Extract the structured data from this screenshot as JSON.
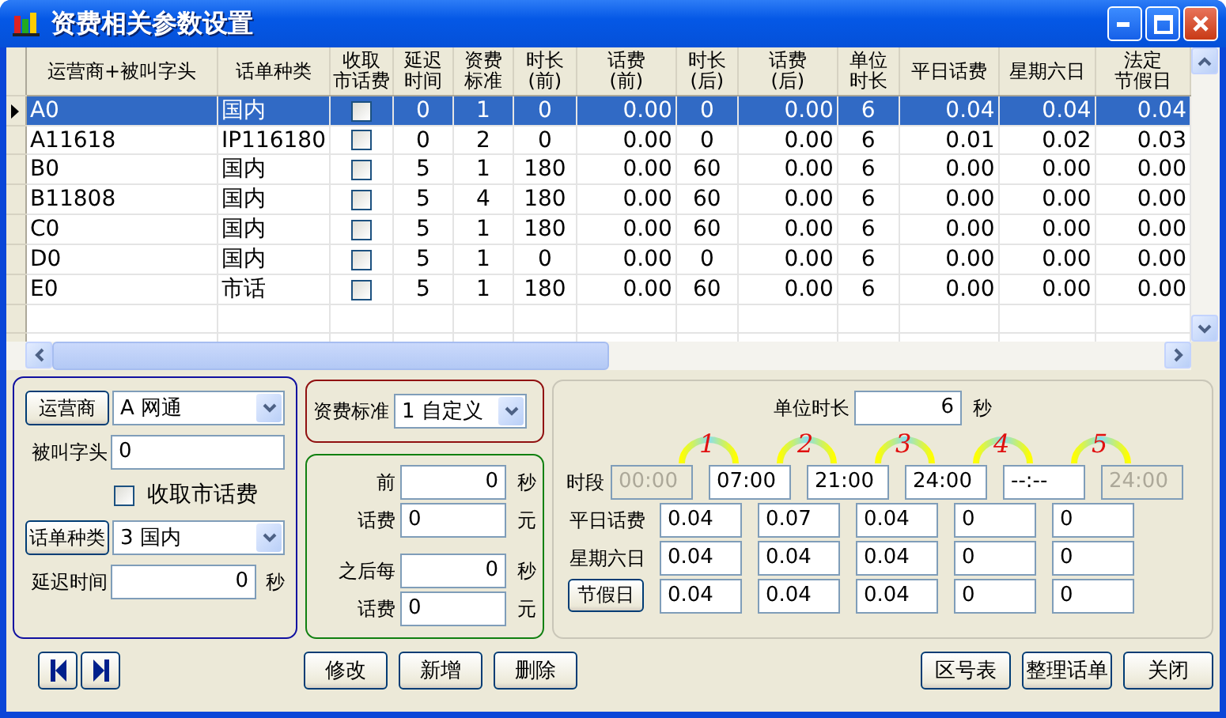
{
  "window": {
    "title": "资费相关参数设置"
  },
  "grid": {
    "columns": [
      {
        "lines": [
          "运营商+被叫字头"
        ],
        "kind": "text"
      },
      {
        "lines": [
          "话单种类"
        ],
        "kind": "text"
      },
      {
        "lines": [
          "收取",
          "市话费"
        ],
        "kind": "check"
      },
      {
        "lines": [
          "延迟",
          "时间"
        ],
        "kind": "text"
      },
      {
        "lines": [
          "资费",
          "标准"
        ],
        "kind": "text"
      },
      {
        "lines": [
          "时长",
          "(前)"
        ],
        "kind": "text"
      },
      {
        "lines": [
          "话费",
          "(前)"
        ],
        "kind": "text"
      },
      {
        "lines": [
          "时长",
          "(后)"
        ],
        "kind": "text"
      },
      {
        "lines": [
          "话费",
          "(后)"
        ],
        "kind": "text"
      },
      {
        "lines": [
          "单位",
          "时长"
        ],
        "kind": "text"
      },
      {
        "lines": [
          "平日话费"
        ],
        "kind": "text"
      },
      {
        "lines": [
          "星期六日"
        ],
        "kind": "text"
      },
      {
        "lines": [
          "法定",
          "节假日"
        ],
        "kind": "text"
      }
    ],
    "rows": [
      {
        "selected": true,
        "city_fee": false,
        "cells": [
          "A0",
          "国内",
          "",
          "0",
          "1",
          "0",
          "0.00",
          "0",
          "0.00",
          "6",
          "0.04",
          "0.04",
          "0.04"
        ]
      },
      {
        "selected": false,
        "city_fee": false,
        "cells": [
          "A11618",
          "IP116180",
          "",
          "0",
          "2",
          "0",
          "0.00",
          "0",
          "0.00",
          "6",
          "0.01",
          "0.02",
          "0.03"
        ]
      },
      {
        "selected": false,
        "city_fee": false,
        "cells": [
          "B0",
          "国内",
          "",
          "5",
          "1",
          "180",
          "0.00",
          "60",
          "0.00",
          "6",
          "0.00",
          "0.00",
          "0.00"
        ]
      },
      {
        "selected": false,
        "city_fee": false,
        "cells": [
          "B11808",
          "国内",
          "",
          "5",
          "4",
          "180",
          "0.00",
          "60",
          "0.00",
          "6",
          "0.00",
          "0.00",
          "0.00"
        ]
      },
      {
        "selected": false,
        "city_fee": false,
        "cells": [
          "C0",
          "国内",
          "",
          "5",
          "1",
          "180",
          "0.00",
          "60",
          "0.00",
          "6",
          "0.00",
          "0.00",
          "0.00"
        ]
      },
      {
        "selected": false,
        "city_fee": false,
        "cells": [
          "D0",
          "国内",
          "",
          "5",
          "1",
          "0",
          "0.00",
          "0",
          "0.00",
          "6",
          "0.00",
          "0.00",
          "0.00"
        ]
      },
      {
        "selected": false,
        "city_fee": false,
        "cells": [
          "E0",
          "市话",
          "",
          "5",
          "1",
          "180",
          "0.00",
          "60",
          "0.00",
          "6",
          "0.00",
          "0.00",
          "0.00"
        ]
      }
    ]
  },
  "carrier_panel": {
    "carrier": {
      "button": "运营商",
      "value": "A 网通"
    },
    "prefix": {
      "label": "被叫字头",
      "value": "0"
    },
    "city_fee": {
      "label": "收取市话费",
      "checked": false
    },
    "bill_type": {
      "button": "话单种类",
      "value": "3 国内"
    },
    "delay": {
      "label": "延迟时间",
      "value": "0",
      "unit": "秒"
    }
  },
  "tariff_standard": {
    "label": "资费标准",
    "value": "1 自定义"
  },
  "fee_panel": [
    {
      "label": "前",
      "value": "0",
      "unit": "秒"
    },
    {
      "label": "话费",
      "value": "0",
      "unit": "元"
    },
    {
      "label": "之后每",
      "value": "0",
      "unit": "秒"
    },
    {
      "label": "话费",
      "value": "0",
      "unit": "元"
    }
  ],
  "period_panel": {
    "unit": {
      "label": "单位时长",
      "value": "6",
      "unit": "秒"
    },
    "period_label": "时段",
    "markers": [
      "1",
      "2",
      "3",
      "4",
      "5"
    ],
    "times": [
      {
        "value": "00:00",
        "disabled": true
      },
      {
        "value": "07:00",
        "disabled": false
      },
      {
        "value": "21:00",
        "disabled": false
      },
      {
        "value": "24:00",
        "disabled": false
      },
      {
        "value": "--:--",
        "disabled": false
      },
      {
        "value": "24:00",
        "disabled": true
      }
    ],
    "rates": [
      {
        "kind": "label",
        "label": "平日话费",
        "values": [
          "0.04",
          "0.07",
          "0.04",
          "0",
          "0"
        ]
      },
      {
        "kind": "label",
        "label": "星期六日",
        "values": [
          "0.04",
          "0.04",
          "0.04",
          "0",
          "0"
        ]
      },
      {
        "kind": "button",
        "label": "节假日",
        "values": [
          "0.04",
          "0.04",
          "0.04",
          "0",
          "0"
        ]
      }
    ]
  },
  "buttons_left": [
    "修改",
    "新增",
    "删除"
  ],
  "buttons_right": [
    "区号表",
    "整理话单",
    "关闭"
  ]
}
